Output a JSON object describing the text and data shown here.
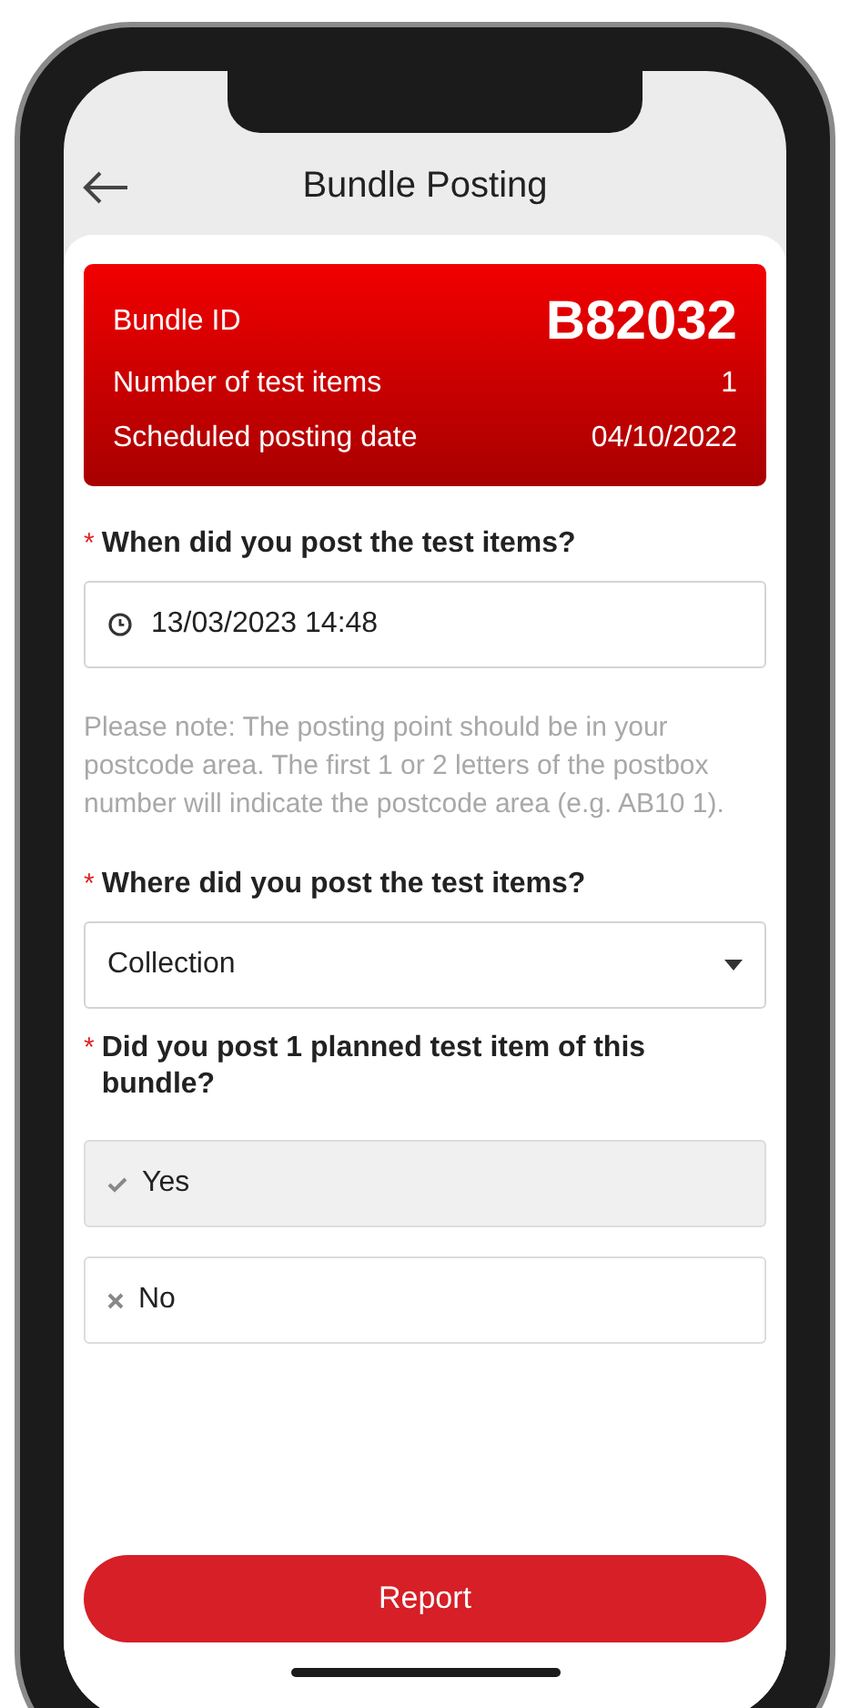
{
  "header": {
    "title": "Bundle Posting"
  },
  "bundle": {
    "label": "Bundle ID",
    "id": "B82032",
    "rows": [
      {
        "label": "Number of test items",
        "value": "1"
      },
      {
        "label": "Scheduled posting date",
        "value": "04/10/2022"
      }
    ]
  },
  "form": [
    {
      "kind": "datetime",
      "marker": "*",
      "label": "When did you post the test items?",
      "value": "13/03/2023 14:48"
    },
    {
      "kind": "note",
      "text": "Please note: The posting point should be in your postcode area. The first 1 or 2 letters of the postbox number will indicate the postcode area (e.g. AB10 1)."
    },
    {
      "kind": "select",
      "marker": "*",
      "label": "Where did you post the test items?",
      "value": "Collection"
    },
    {
      "kind": "choice",
      "marker": "*",
      "label": "Did you post 1 planned test item of this bundle?",
      "options": [
        {
          "label": "Yes",
          "selected": true
        },
        {
          "label": "No",
          "selected": false
        }
      ]
    }
  ],
  "submit": {
    "label": "Report"
  }
}
